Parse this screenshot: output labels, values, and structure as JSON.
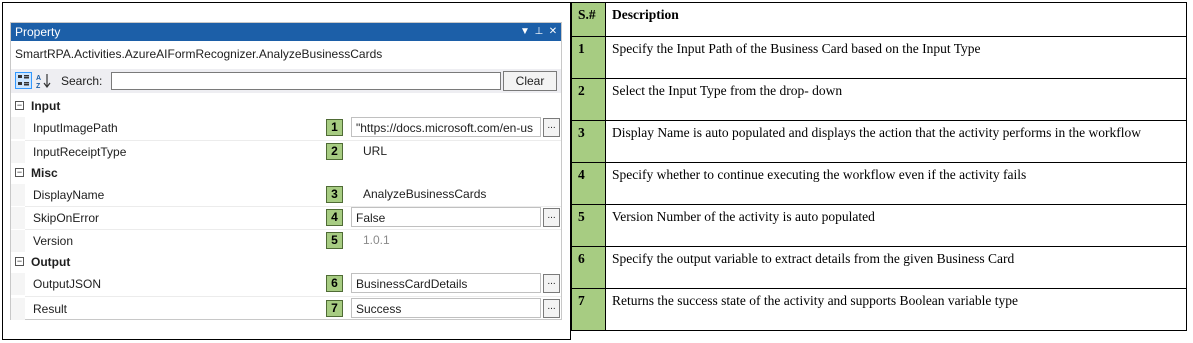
{
  "panel": {
    "title": "Property",
    "controls": [
      "▼",
      "⊥",
      "✕"
    ],
    "type_name": "SmartRPA.Activities.AzureAIFormRecognizer.AnalyzeBusinessCards",
    "search_label": "Search:",
    "search_value": "",
    "clear_label": "Clear",
    "categories": [
      {
        "label": "Input",
        "properties": [
          {
            "name": "InputImagePath",
            "value": "\"https://docs.microsoft.com/en-us",
            "callout": "1",
            "has_button": true,
            "boxed": true
          },
          {
            "name": "InputReceiptType",
            "value": "URL",
            "callout": "2",
            "has_button": false,
            "boxed": false
          }
        ]
      },
      {
        "label": "Misc",
        "properties": [
          {
            "name": "DisplayName",
            "value": "AnalyzeBusinessCards",
            "callout": "3",
            "has_button": false,
            "boxed": false
          },
          {
            "name": "SkipOnError",
            "value": "False",
            "callout": "4",
            "has_button": true,
            "boxed": true
          },
          {
            "name": "Version",
            "value": "1.0.1",
            "callout": "5",
            "has_button": false,
            "boxed": false
          }
        ]
      },
      {
        "label": "Output",
        "properties": [
          {
            "name": "OutputJSON",
            "value": "BusinessCardDetails",
            "callout": "6",
            "has_button": true,
            "boxed": true
          },
          {
            "name": "Result",
            "value": "Success",
            "callout": "7",
            "has_button": true,
            "boxed": true
          }
        ]
      }
    ],
    "ellipsis_label": "...",
    "expander_symbol": "−"
  },
  "table": {
    "headers": {
      "sn": "S.#",
      "desc": "Description"
    },
    "rows": [
      {
        "sn": "1",
        "desc": "Specify the Input Path of the Business Card based on the Input Type"
      },
      {
        "sn": "2",
        "desc": "Select the Input Type from the drop- down"
      },
      {
        "sn": "3",
        "desc": "Display Name is auto populated and displays the action that the activity performs in the workflow"
      },
      {
        "sn": "4",
        "desc": "Specify whether to continue executing the workflow even if the activity fails"
      },
      {
        "sn": "5",
        "desc": "Version Number of the activity is auto populated"
      },
      {
        "sn": "6",
        "desc": "Specify the output variable to extract details from the given Business Card"
      },
      {
        "sn": "7",
        "desc": "Returns the success state of the activity and supports Boolean variable type"
      }
    ]
  },
  "colors": {
    "titlebar": "#1c5fa8",
    "callout_green": "#a7cc82"
  }
}
